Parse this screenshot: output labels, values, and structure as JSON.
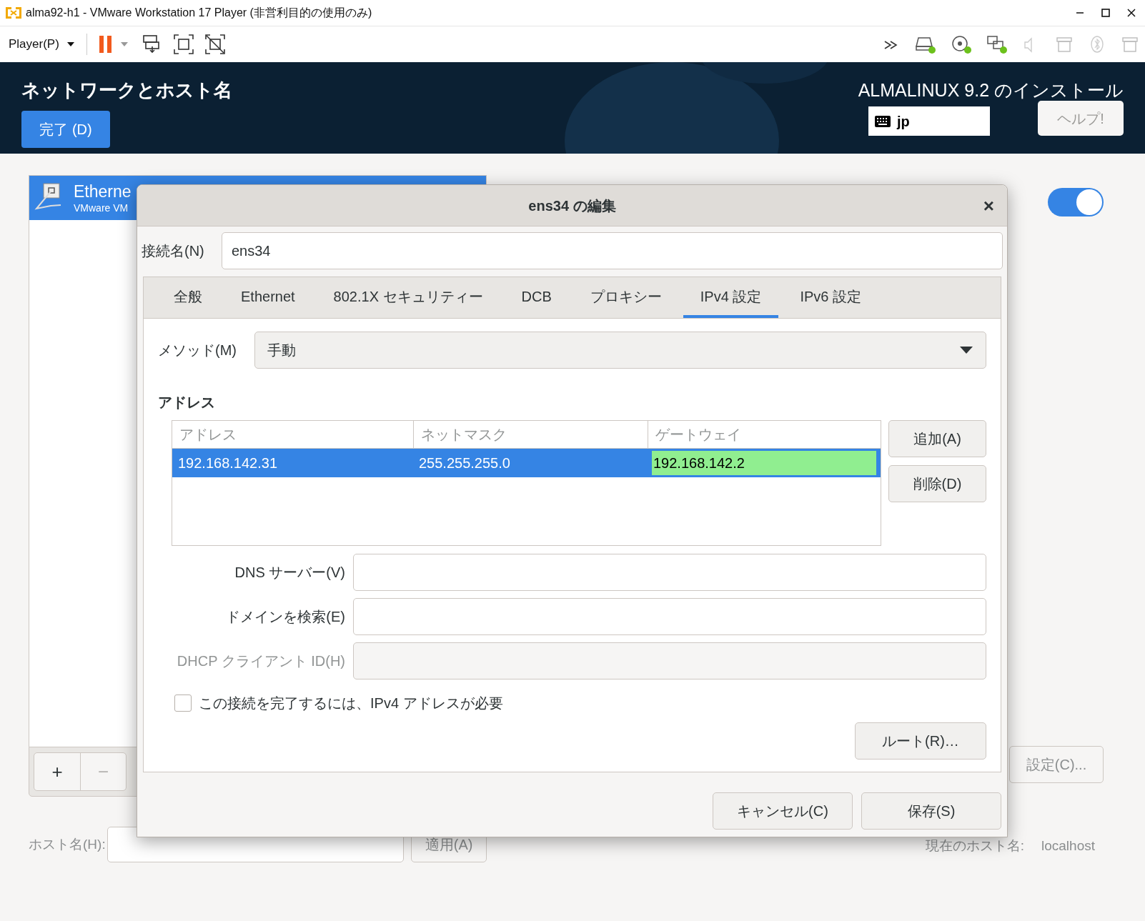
{
  "window": {
    "title": "alma92-h1 - VMware Workstation 17 Player (非営利目的の使用のみ)"
  },
  "toolbar": {
    "player_menu": "Player(P)"
  },
  "installer": {
    "title": "ネットワークとホスト名",
    "done_button": "完了 (D)",
    "product": "ALMALINUX 9.2 のインストール",
    "keyboard_layout": "jp",
    "help_button": "ヘルプ!",
    "devices": [
      {
        "name": "Etherne",
        "description": "VMware VM",
        "selected": true
      }
    ],
    "device_switch": {
      "on": true
    },
    "configure_button": "設定(C)...",
    "add_button": {
      "label": "+",
      "disabled": false
    },
    "remove_button": {
      "label": "−",
      "disabled": true
    },
    "hostname_label": "ホスト名(H):",
    "apply_button": "適用(A)",
    "current_hostname_label": "現在のホスト名:",
    "current_hostname": "localhost"
  },
  "dialog": {
    "title": "ens34 の編集",
    "close": "×",
    "connection_name_label": "接続名(N)",
    "connection_name": "ens34",
    "tabs": [
      {
        "label": "全般",
        "selected": false
      },
      {
        "label": "Ethernet",
        "selected": false
      },
      {
        "label": "802.1X セキュリティー",
        "selected": false
      },
      {
        "label": "DCB",
        "selected": false
      },
      {
        "label": "プロキシー",
        "selected": false
      },
      {
        "label": "IPv4 設定",
        "selected": true
      },
      {
        "label": "IPv6 設定",
        "selected": false
      }
    ],
    "method_label": "メソッド(M)",
    "method": "手動",
    "addresses_heading": "アドレス",
    "address_columns": [
      "アドレス",
      "ネットマスク",
      "ゲートウェイ"
    ],
    "address_rows": [
      {
        "selected": true,
        "cells": [
          {
            "text": "192.168.142.31",
            "editing": false
          },
          {
            "text": "255.255.255.0",
            "editing": false
          },
          {
            "text": "192.168.142.2",
            "editing": true
          }
        ]
      }
    ],
    "add_button": "追加(A)",
    "delete_button": "削除(D)",
    "fields": [
      {
        "label": "DNS サーバー(V)",
        "disabled": false
      },
      {
        "label": "ドメインを検索(E)",
        "disabled": false
      },
      {
        "label": "DHCP クライアント ID(H)",
        "disabled": true
      }
    ],
    "require_ipv4": {
      "label": "この接続を完了するには、IPv4 アドレスが必要",
      "checked": false
    },
    "routes_button": "ルート(R)…",
    "cancel_button": "キャンセル(C)",
    "save_button": "保存(S)"
  }
}
